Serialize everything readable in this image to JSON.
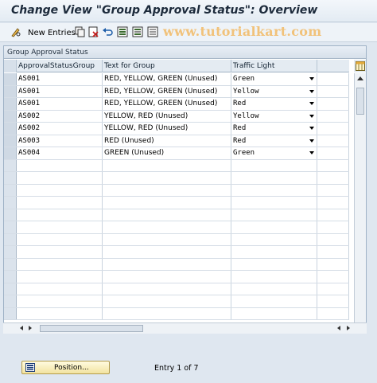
{
  "window": {
    "title": "Change View \"Group Approval Status\": Overview"
  },
  "toolbar": {
    "new_entries_label": "New Entries",
    "icons": [
      "pencil-glasses-icon",
      "copy-icon",
      "delete-icon",
      "undo-icon",
      "select-all-icon",
      "select-block-icon",
      "deselect-all-icon"
    ],
    "watermark": "www.tutorialkart.com"
  },
  "table": {
    "caption": "Group Approval Status",
    "columns": [
      "ApprovalStatusGroup",
      "Text for Group",
      "Traffic Light"
    ],
    "rows": [
      {
        "group": "AS001",
        "text": "RED, YELLOW, GREEN (Unused)",
        "light": "Green"
      },
      {
        "group": "AS001",
        "text": "RED, YELLOW, GREEN (Unused)",
        "light": "Yellow"
      },
      {
        "group": "AS001",
        "text": "RED, YELLOW, GREEN (Unused)",
        "light": "Red"
      },
      {
        "group": "AS002",
        "text": "YELLOW, RED (Unused)",
        "light": "Yellow"
      },
      {
        "group": "AS002",
        "text": "YELLOW, RED (Unused)",
        "light": "Red"
      },
      {
        "group": "AS003",
        "text": "RED (Unused)",
        "light": "Red"
      },
      {
        "group": "AS004",
        "text": "GREEN (Unused)",
        "light": "Green"
      }
    ],
    "empty_rows": 13
  },
  "footer": {
    "position_label": "Position...",
    "entry_text": "Entry 1 of 7"
  }
}
